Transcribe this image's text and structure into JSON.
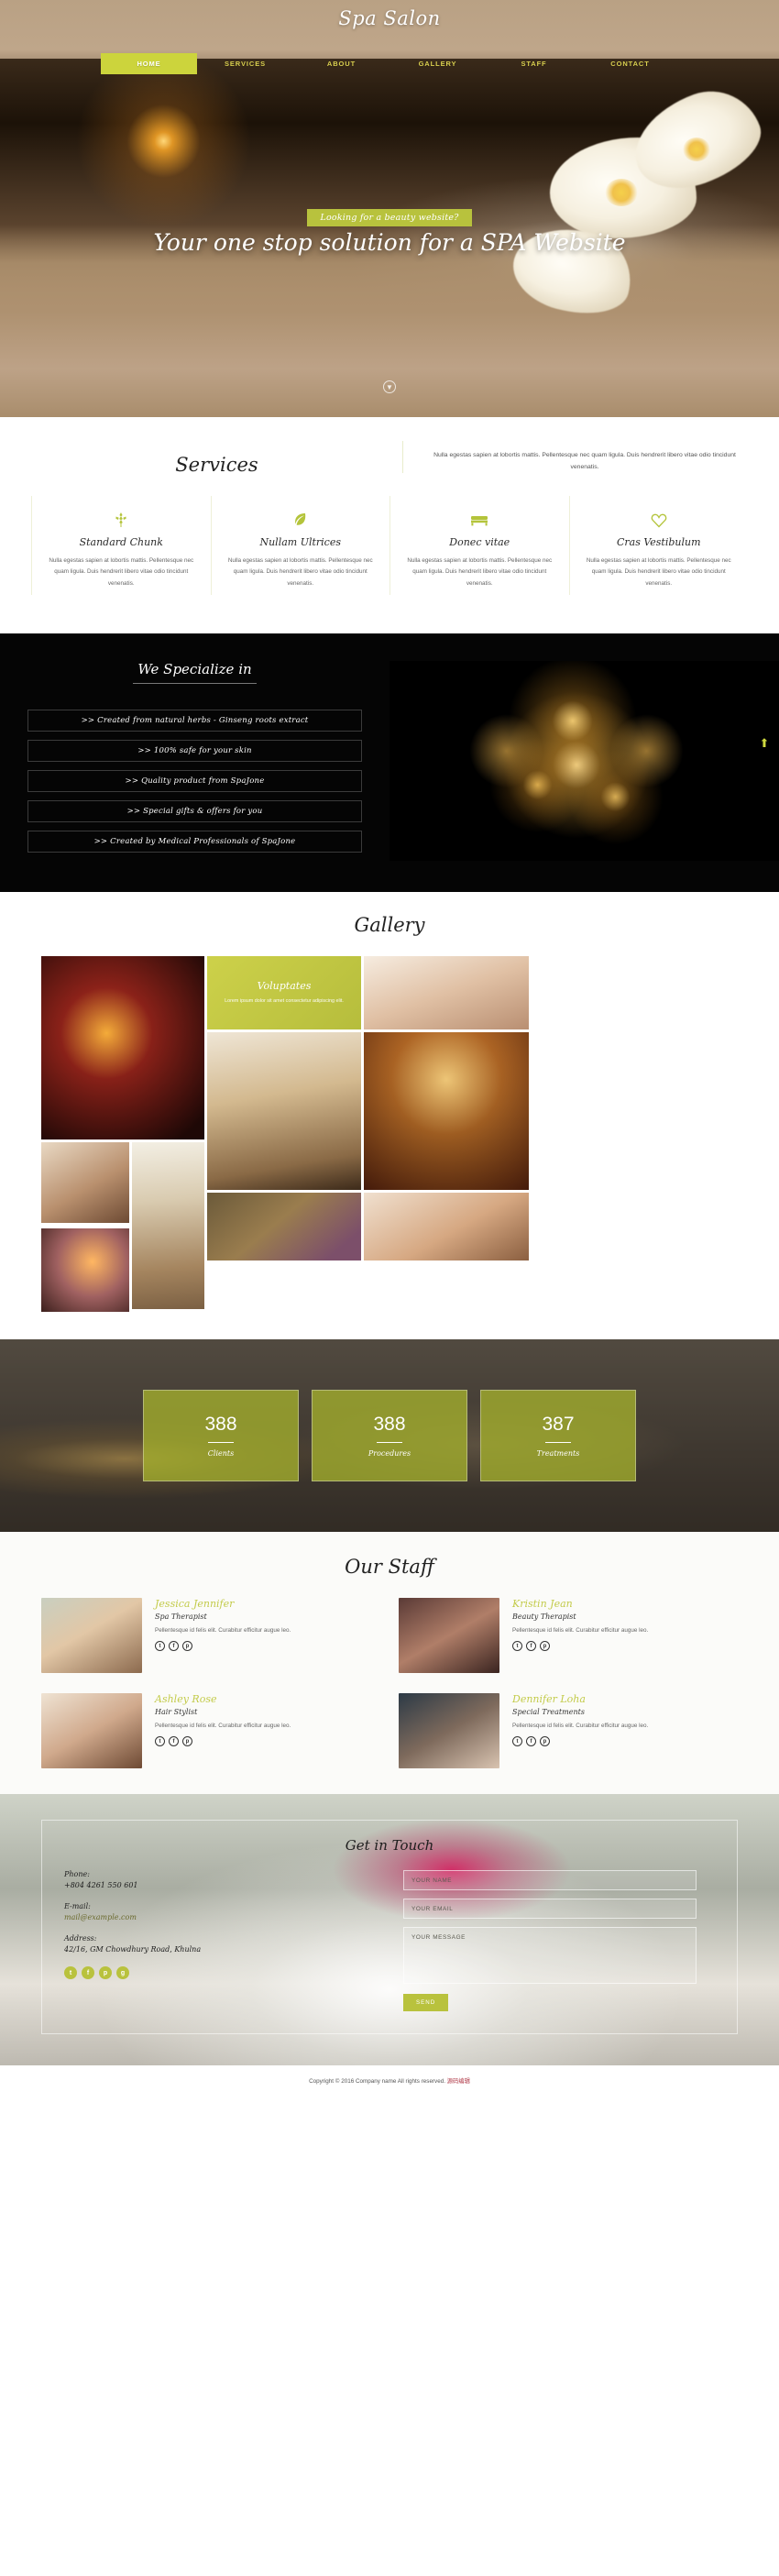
{
  "site": {
    "title": "Spa Salon"
  },
  "nav": {
    "items": [
      {
        "label": "HOME",
        "active": true
      },
      {
        "label": "SERVICES",
        "active": false
      },
      {
        "label": "ABOUT",
        "active": false
      },
      {
        "label": "GALLERY",
        "active": false
      },
      {
        "label": "STAFF",
        "active": false
      },
      {
        "label": "CONTACT",
        "active": false
      }
    ]
  },
  "hero": {
    "badge": "Looking for a beauty website?",
    "title": "Your one stop solution for a SPA Website",
    "scroll_icon": "▼"
  },
  "services": {
    "heading": "Services",
    "intro": "Nulla egestas sapien at lobortis mattis. Pellentesque nec quam ligula. Duis hendrerit libero vitae odio tincidunt venenatis.",
    "cards": [
      {
        "icon": "wheat-icon",
        "title": "Standard Chunk",
        "text": "Nulla egestas sapien at lobortis mattis. Pellentesque nec quam ligula. Duis hendrerit libero vitae odio tincidunt venenatis."
      },
      {
        "icon": "leaf-icon",
        "title": "Nullam Ultrices",
        "text": "Nulla egestas sapien at lobortis mattis. Pellentesque nec quam ligula. Duis hendrerit libero vitae odio tincidunt venenatis."
      },
      {
        "icon": "bed-icon",
        "title": "Donec vitae",
        "text": "Nulla egestas sapien at lobortis mattis. Pellentesque nec quam ligula. Duis hendrerit libero vitae odio tincidunt venenatis."
      },
      {
        "icon": "heart-icon",
        "title": "Cras Vestibulum",
        "text": "Nulla egestas sapien at lobortis mattis. Pellentesque nec quam ligula. Duis hendrerit libero vitae odio tincidunt venenatis."
      }
    ]
  },
  "specialize": {
    "heading": "We Specialize in",
    "items": [
      ">> Created from natural herbs - Ginseng roots extract",
      ">> 100% safe for your skin",
      ">> Quality product from SpaJone",
      ">> Special gifts & offers for you",
      ">> Created by Medical Professionals of SpaJone"
    ],
    "scroll_top_icon": "⬆"
  },
  "gallery": {
    "heading": "Gallery",
    "feature_tile": {
      "title": "Voluptates",
      "text": "Lorem ipsum dolor sit amet consectetur adipiscing elit."
    }
  },
  "counters": [
    {
      "value": "388",
      "label": "Clients"
    },
    {
      "value": "388",
      "label": "Procedures"
    },
    {
      "value": "387",
      "label": "Treatments"
    }
  ],
  "staff": {
    "heading": "Our Staff",
    "members": [
      {
        "name": "Jessica Jennifer",
        "role": "Spa Therapist",
        "bio": "Pellentesque id felis elit. Curabitur efficitur augue leo.",
        "social": [
          "twitter-icon",
          "facebook-icon",
          "pinterest-icon"
        ]
      },
      {
        "name": "Kristin Jean",
        "role": "Beauty Therapist",
        "bio": "Pellentesque id felis elit. Curabitur efficitur augue leo.",
        "social": [
          "twitter-icon",
          "facebook-icon",
          "pinterest-icon"
        ]
      },
      {
        "name": "Ashley Rose",
        "role": "Hair Stylist",
        "bio": "Pellentesque id felis elit. Curabitur efficitur augue leo.",
        "social": [
          "twitter-icon",
          "facebook-icon",
          "pinterest-icon"
        ]
      },
      {
        "name": "Dennifer Loha",
        "role": "Special Treatments",
        "bio": "Pellentesque id felis elit. Curabitur efficitur augue leo.",
        "social": [
          "twitter-icon",
          "facebook-icon",
          "pinterest-icon"
        ]
      }
    ]
  },
  "contact": {
    "heading": "Get in Touch",
    "phone_label": "Phone:",
    "phone_value": "+804 4261 550 601",
    "email_label": "E-mail:",
    "email_value": "mail@example.com",
    "address_label": "Address:",
    "address_value": "42/16, GM Chowdhury Road, Khulna",
    "social": [
      "twitter-icon",
      "facebook-icon",
      "pinterest-icon",
      "google-icon"
    ],
    "form": {
      "name_placeholder": "YOUR NAME",
      "email_placeholder": "YOUR EMAIL",
      "message_placeholder": "YOUR MESSAGE",
      "send_label": "SEND"
    }
  },
  "footer": {
    "copyright": "Copyright © 2016 Company name All rights reserved.",
    "credit": "源码编辑"
  },
  "colors": {
    "accent": "#b9c23d",
    "accent_light": "#ccd43c",
    "dark": "#050505"
  }
}
